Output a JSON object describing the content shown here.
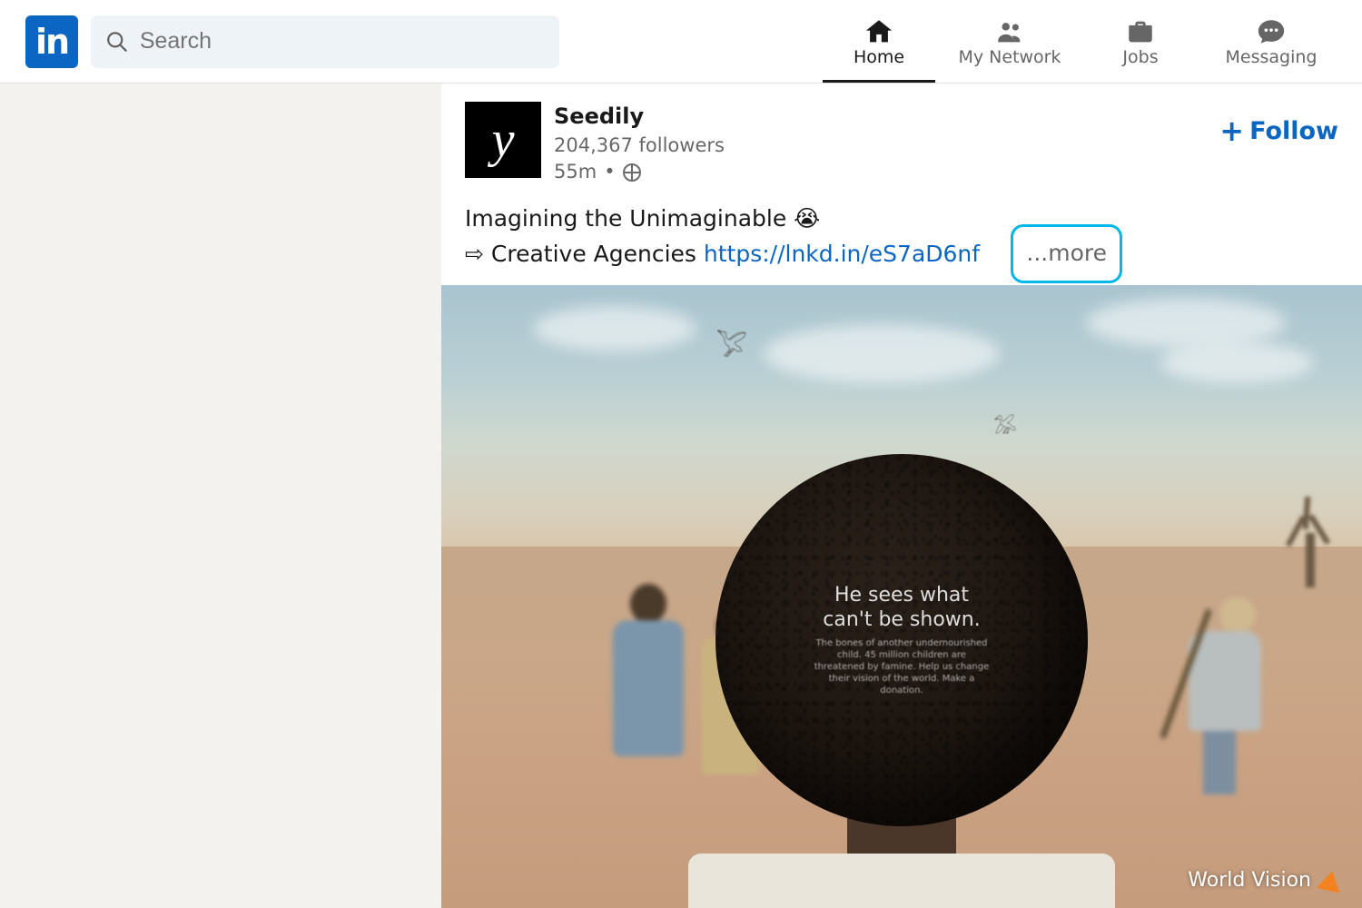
{
  "header": {
    "search_placeholder": "Search",
    "nav": {
      "home": "Home",
      "network": "My Network",
      "jobs": "Jobs",
      "messaging": "Messaging"
    }
  },
  "post": {
    "company": "Seedily",
    "followers": "204,367 followers",
    "time": "55m",
    "follow_label": "Follow",
    "body": {
      "line1_text": "Imagining the Unimaginable ",
      "line1_emoji": "😭",
      "line2_prefix": "⇨ Creative Agencies ",
      "link_text": "https://lnkd.in/eS7aD6nf",
      "more_label": "...more"
    },
    "image": {
      "headline": "He sees what can't be shown.",
      "subline": "The bones of another undernourished child. 45 million children are threatened by famine. Help us change their vision of the world. Make a donation.",
      "brand": "World Vision"
    }
  }
}
